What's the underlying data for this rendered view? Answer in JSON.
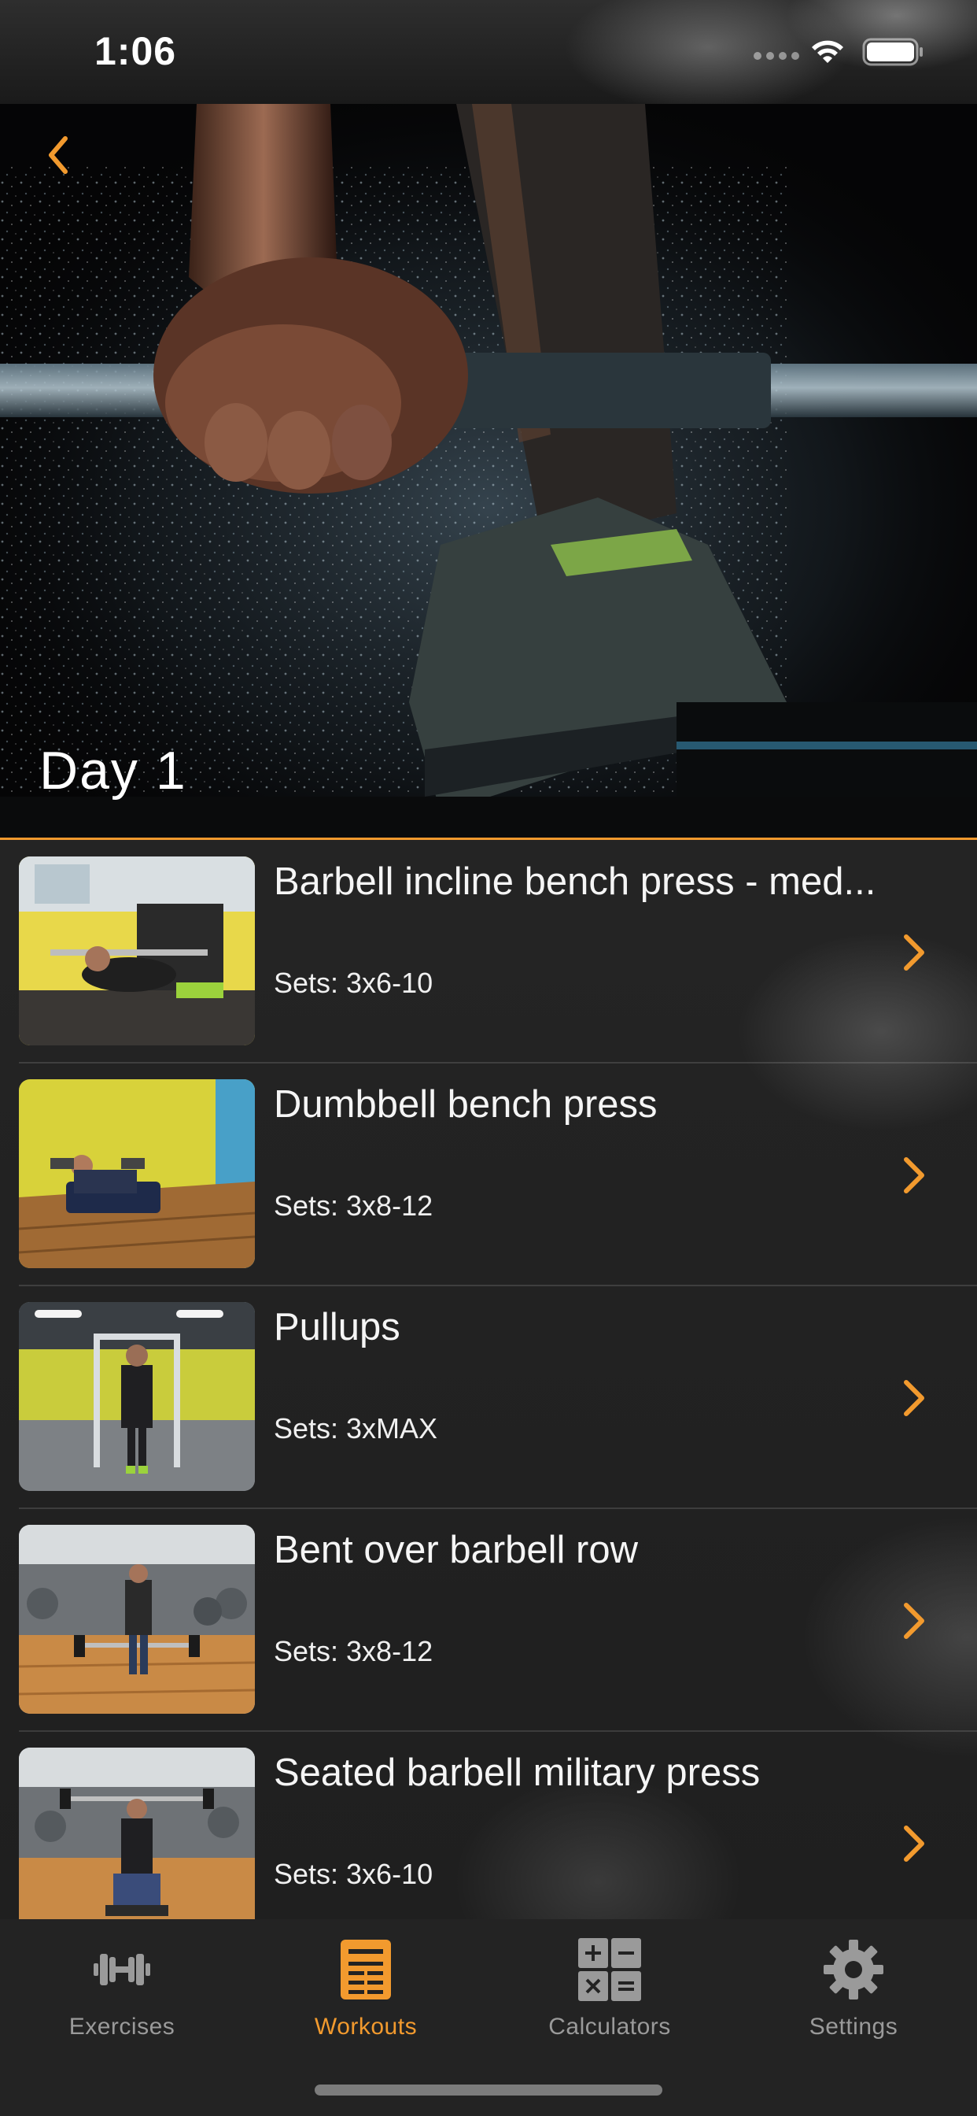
{
  "status_bar": {
    "time": "1:06"
  },
  "hero": {
    "title": "Day 1",
    "back_icon": "chevron-left-icon"
  },
  "exercises": [
    {
      "name": "Barbell incline bench press - med...",
      "sets": "Sets: 3x6-10"
    },
    {
      "name": "Dumbbell bench press",
      "sets": "Sets: 3x8-12"
    },
    {
      "name": "Pullups",
      "sets": "Sets: 3xMAX"
    },
    {
      "name": "Bent over barbell row",
      "sets": "Sets: 3x8-12"
    },
    {
      "name": "Seated barbell military press",
      "sets": "Sets: 3x6-10"
    }
  ],
  "tab_bar": {
    "active": "Workouts",
    "tabs": [
      {
        "label": "Exercises",
        "icon": "dumbbell-icon"
      },
      {
        "label": "Workouts",
        "icon": "workout-sheet-icon"
      },
      {
        "label": "Calculators",
        "icon": "calculator-icon"
      },
      {
        "label": "Settings",
        "icon": "gear-icon"
      }
    ]
  },
  "colors": {
    "accent": "#f29a2e",
    "inactive": "#9a9a9a",
    "background": "#232323"
  }
}
